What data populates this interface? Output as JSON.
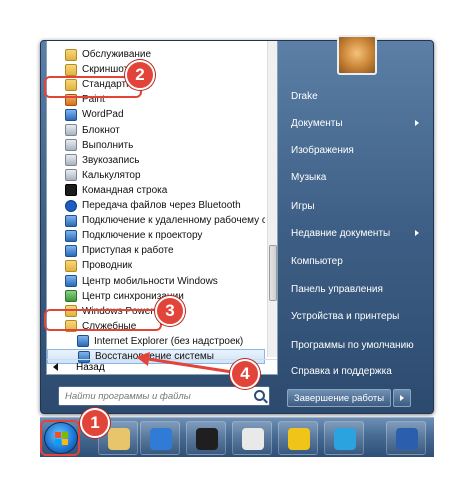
{
  "program_list": [
    {
      "label": "Обслуживание",
      "icon": "folder-icon",
      "kind": "folder"
    },
    {
      "label": "Скриншоттер",
      "icon": "folder-icon",
      "kind": "folder"
    },
    {
      "label": "Стандартные",
      "icon": "folder-icon",
      "kind": "folder"
    },
    {
      "label": "Paint",
      "icon": "paint-icon",
      "kind": "app"
    },
    {
      "label": "WordPad",
      "icon": "wordpad-icon",
      "kind": "app"
    },
    {
      "label": "Блокнот",
      "icon": "notepad-icon",
      "kind": "app"
    },
    {
      "label": "Выполнить",
      "icon": "run-icon",
      "kind": "app"
    },
    {
      "label": "Звукозапись",
      "icon": "microphone-icon",
      "kind": "app"
    },
    {
      "label": "Калькулятор",
      "icon": "calculator-icon",
      "kind": "app"
    },
    {
      "label": "Командная строка",
      "icon": "command-prompt-icon",
      "kind": "app"
    },
    {
      "label": "Передача файлов через Bluetooth",
      "icon": "bluetooth-icon",
      "kind": "app"
    },
    {
      "label": "Подключение к удаленному рабочему сто",
      "icon": "remote-desktop-icon",
      "kind": "app"
    },
    {
      "label": "Подключение к проектору",
      "icon": "projector-icon",
      "kind": "app"
    },
    {
      "label": "Приступая к работе",
      "icon": "getting-started-icon",
      "kind": "app"
    },
    {
      "label": "Проводник",
      "icon": "explorer-icon",
      "kind": "app"
    },
    {
      "label": "Центр мобильности Windows",
      "icon": "mobility-center-icon",
      "kind": "app"
    },
    {
      "label": "Центр синхронизации",
      "icon": "sync-center-icon",
      "kind": "app"
    },
    {
      "label": "Windows PowerShell",
      "icon": "folder-icon",
      "kind": "folder"
    },
    {
      "label": "Служебные",
      "icon": "folder-icon",
      "kind": "folder"
    },
    {
      "label": "Internet Explorer (без надстроек)",
      "icon": "internet-explorer-icon",
      "kind": "subapp"
    },
    {
      "label": "Восстановление системы",
      "icon": "system-restore-icon",
      "kind": "subapp",
      "selected": true
    }
  ],
  "back_label": "Назад",
  "search_placeholder": "Найти программы и файлы",
  "right_items": [
    {
      "label": "Drake",
      "arrow": false
    },
    {
      "label": "Документы",
      "arrow": true
    },
    {
      "label": "Изображения",
      "arrow": false
    },
    {
      "label": "Музыка",
      "arrow": false
    },
    {
      "label": "Игры",
      "arrow": false
    },
    {
      "label": "Недавние документы",
      "arrow": true
    },
    {
      "label": "Компьютер",
      "arrow": false
    },
    {
      "label": "Панель управления",
      "arrow": false
    },
    {
      "label": "Устройства и принтеры",
      "arrow": false
    },
    {
      "label": "Программы по умолчанию",
      "arrow": false
    },
    {
      "label": "Справка и поддержка",
      "arrow": false
    }
  ],
  "shutdown_label": "Завершение работы",
  "badges": [
    "1",
    "2",
    "3",
    "4"
  ],
  "taskbar_icons": [
    "windows-explorer-icon",
    "media-player-icon",
    "hp-icon",
    "chrome-icon",
    "network-icon",
    "telegram-icon",
    "word-icon"
  ],
  "colors": {
    "accent": "#e2443a",
    "menu_blue": "#3e5f85",
    "selection": "#cfe4f9"
  }
}
